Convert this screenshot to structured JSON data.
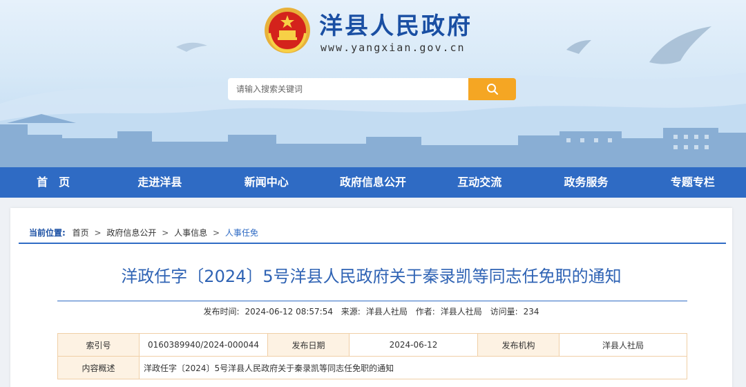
{
  "header": {
    "site_title": "洋县人民政府",
    "site_url": "www.yangxian.gov.cn",
    "search_placeholder": "请输入搜索关键词",
    "emblem_icon": "national-emblem-icon",
    "search_icon": "search-icon",
    "accent_color": "#f5a623"
  },
  "nav": {
    "items": [
      {
        "label": "首　页"
      },
      {
        "label": "走进洋县"
      },
      {
        "label": "新闻中心"
      },
      {
        "label": "政府信息公开"
      },
      {
        "label": "互动交流"
      },
      {
        "label": "政务服务"
      },
      {
        "label": "专题专栏"
      }
    ],
    "color": "#2f6bc4"
  },
  "breadcrumb": {
    "lead": "当前位置:",
    "items": [
      "首页",
      "政府信息公开",
      "人事信息",
      "人事任免"
    ],
    "separator": ">"
  },
  "article": {
    "title": "洋政任字〔2024〕5号洋县人民政府关于秦录凯等同志任免职的通知",
    "meta": {
      "publish_time_label": "发布时间:",
      "publish_time": "2024-06-12 08:57:54",
      "source_label": "来源:",
      "source": "洋县人社局",
      "author_label": "作者:",
      "author": "洋县人社局",
      "views_label": "访问量:",
      "views": "234"
    }
  },
  "info_table": {
    "index_label": "索引号",
    "index_value": "0160389940/2024-000044",
    "date_label": "发布日期",
    "date_value": "2024-06-12",
    "org_label": "发布机构",
    "org_value": "洋县人社局",
    "summary_label": "内容概述",
    "summary_value": "洋政任字〔2024〕5号洋县人民政府关于秦录凯等同志任免职的通知"
  }
}
